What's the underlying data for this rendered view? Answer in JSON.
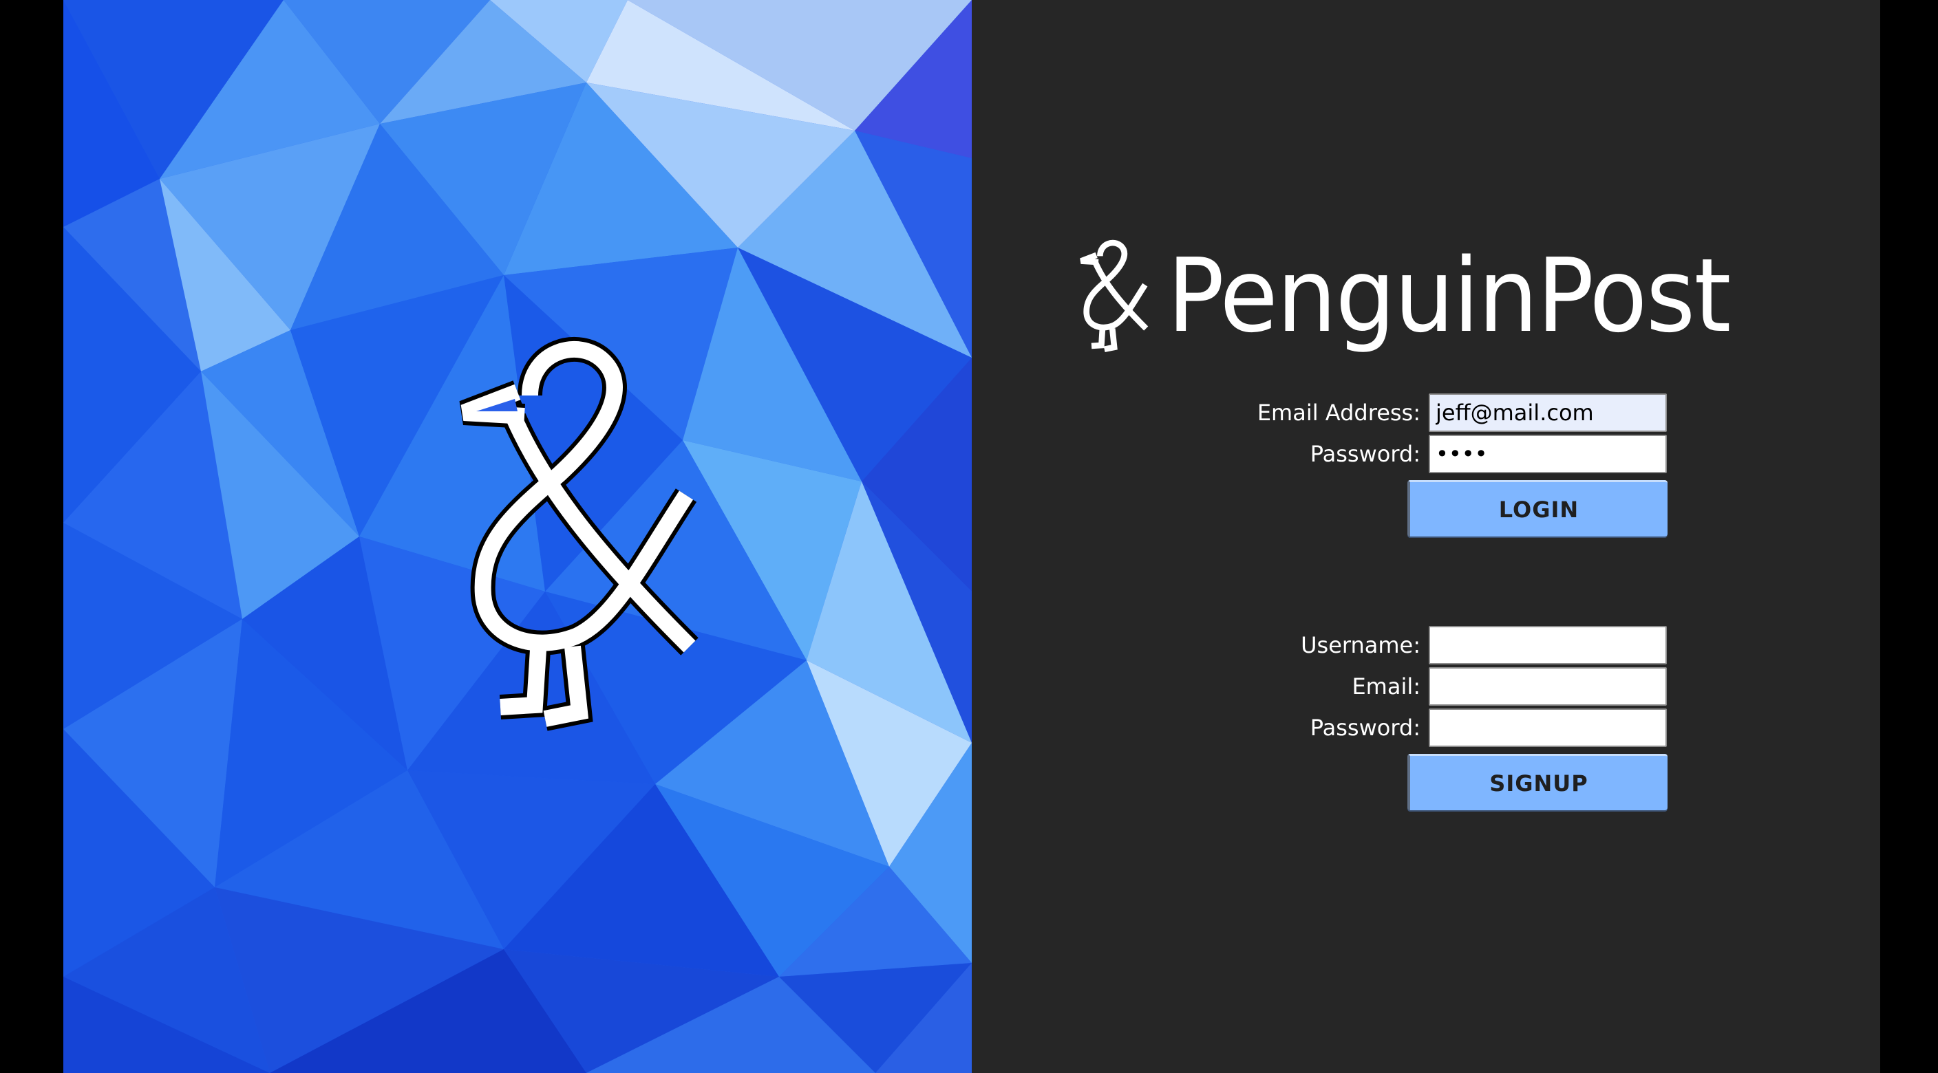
{
  "brand": {
    "name": "PenguinPost",
    "logo_icon": "penguin-ampersand-icon"
  },
  "colors": {
    "background": "#000000",
    "panel": "#262626",
    "hero_blue": "#1e5ef0",
    "button": "#7fb6ff",
    "autofill_input": "#e8eefc"
  },
  "login": {
    "email_label": "Email Address:",
    "email_value": "jeff@mail.com",
    "password_label": "Password:",
    "password_value": "••••",
    "button_label": "LOGIN"
  },
  "signup": {
    "username_label": "Username:",
    "username_value": "",
    "email_label": "Email:",
    "email_value": "",
    "password_label": "Password:",
    "password_value": "",
    "button_label": "SIGNUP"
  }
}
